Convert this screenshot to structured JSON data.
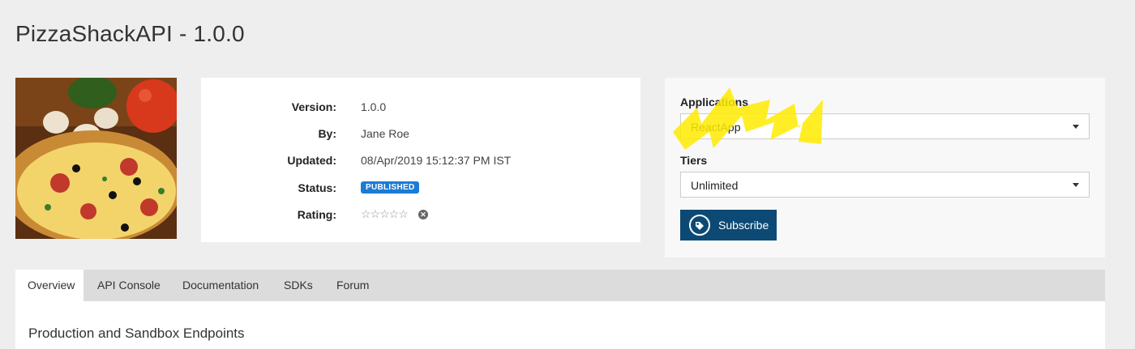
{
  "page": {
    "title": "PizzaShackAPI - 1.0.0"
  },
  "thumbnail": {
    "icon": "pizza-image"
  },
  "info": {
    "version_label": "Version:",
    "version": "1.0.0",
    "by_label": "By:",
    "by": "Jane Roe",
    "updated_label": "Updated:",
    "updated": "08/Apr/2019 15:12:37 PM IST",
    "status_label": "Status:",
    "status": "PUBLISHED",
    "rating_label": "Rating:",
    "rating": 0,
    "rating_max": 5,
    "stars": "☆☆☆☆☆",
    "clear_icon": "✕"
  },
  "subscribe": {
    "applications_label": "Applications",
    "application": "ReactApp",
    "tiers_label": "Tiers",
    "tier": "Unlimited",
    "button_label": "Subscribe",
    "button_color": "#0c4a75",
    "highlight_color": "#ffeb00"
  },
  "tabs": [
    {
      "label": "Overview",
      "active": true
    },
    {
      "label": "API Console",
      "active": false
    },
    {
      "label": "Documentation",
      "active": false
    },
    {
      "label": "SDKs",
      "active": false
    },
    {
      "label": "Forum",
      "active": false
    }
  ],
  "content": {
    "section_title": "Production and Sandbox Endpoints"
  }
}
